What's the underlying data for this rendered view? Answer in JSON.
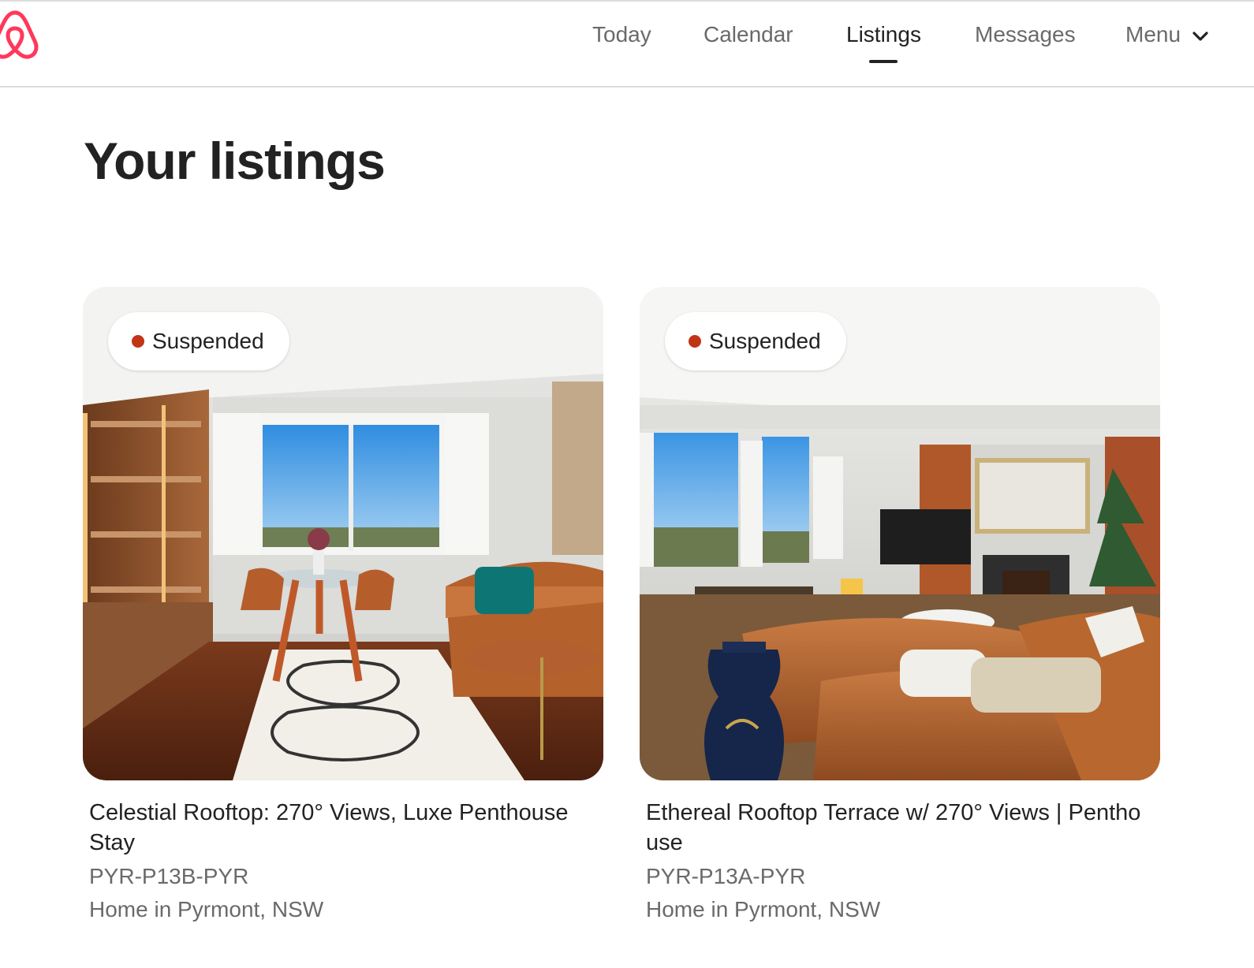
{
  "header": {
    "logo_icon": "airbnb-belo-icon",
    "brand_color": "#FF385C",
    "nav": [
      {
        "label": "Today",
        "active": false
      },
      {
        "label": "Calendar",
        "active": false
      },
      {
        "label": "Listings",
        "active": true
      },
      {
        "label": "Messages",
        "active": false
      },
      {
        "label": "Menu",
        "active": false,
        "icon": "chevron-down-icon"
      }
    ]
  },
  "main": {
    "title": "Your listings",
    "listings": [
      {
        "status": "Suspended",
        "status_color": "#C13515",
        "title": "Celestial Rooftop: 270° Views, Luxe Penthouse Stay",
        "code": "PYR-P13B-PYR",
        "location": "Home in Pyrmont, NSW"
      },
      {
        "status": "Suspended",
        "status_color": "#C13515",
        "title": "Ethereal Rooftop Terrace w/ 270° Views | Penthouse",
        "code": "PYR-P13A-PYR",
        "location": "Home in Pyrmont, NSW"
      }
    ]
  }
}
